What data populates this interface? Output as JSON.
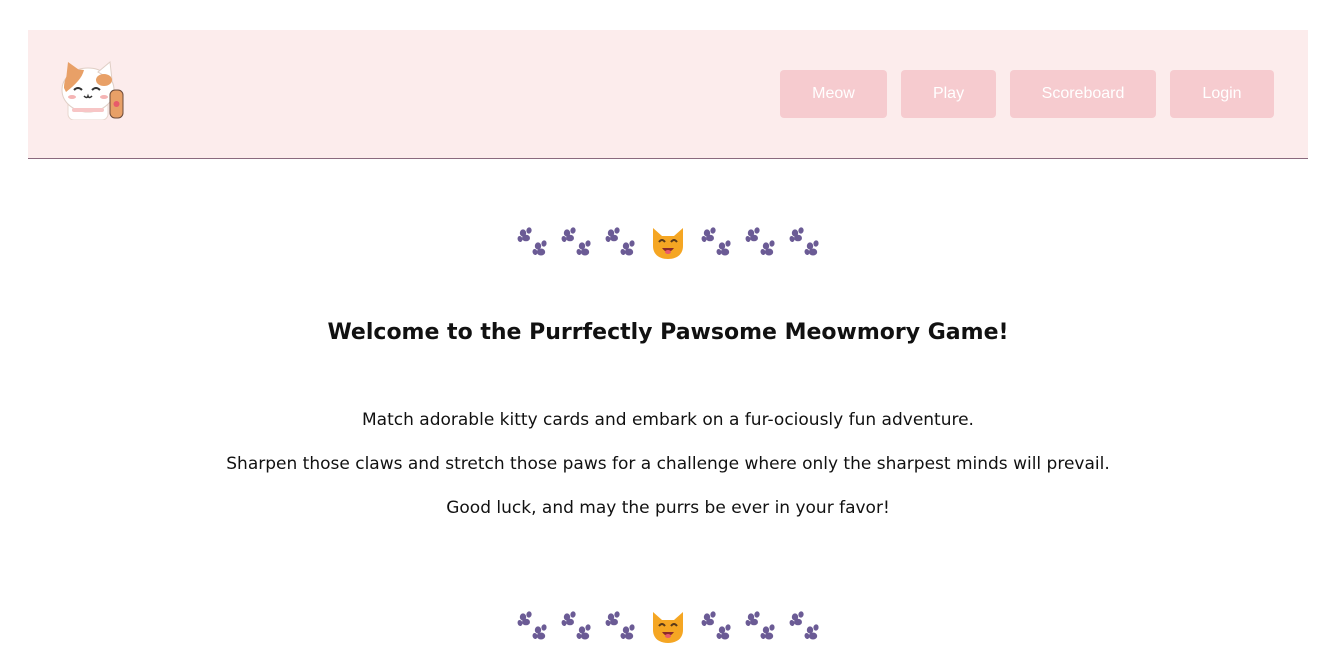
{
  "header": {
    "logo_icon": "cat-waving-logo-icon",
    "nav": {
      "meow_label": "Meow",
      "play_label": "Play",
      "scoreboard_label": "Scoreboard",
      "login_label": "Login"
    }
  },
  "decor": {
    "paw_icon": "paw-prints-icon",
    "cat_icon": "smiling-cat-face-icon",
    "paw_color": "#6b5b95",
    "cat_color": "#f5a623"
  },
  "main": {
    "title": "Welcome to the Purrfectly Pawsome Meowmory Game!",
    "paragraphs": [
      "Match adorable kitty cards and embark on a fur-ociously fun adventure.",
      "Sharpen those claws and stretch those paws for a challenge where only the sharpest minds will prevail.",
      "Good luck, and may the purrs be ever in your favor!"
    ]
  },
  "colors": {
    "header_bg": "#fcecec",
    "button_bg": "#f6cbcf",
    "button_text": "#ffffff"
  }
}
